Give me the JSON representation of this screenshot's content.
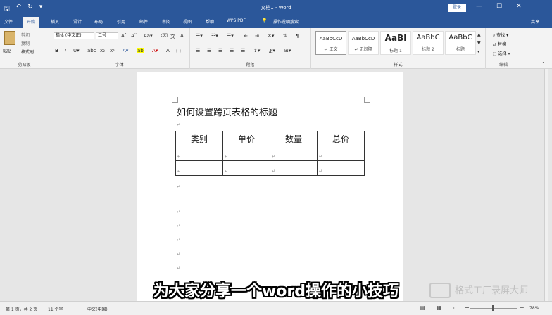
{
  "titlebar": {
    "title": "文档1 - Word",
    "login": "登录",
    "minimize": "—",
    "restore": "☐",
    "close": "✕"
  },
  "tabs": [
    "文件",
    "开始",
    "插入",
    "设计",
    "布局",
    "引用",
    "邮件",
    "审阅",
    "视图",
    "帮助",
    "WPS PDF"
  ],
  "tell_me": "操作说明搜索",
  "share": "共享",
  "clipboard": {
    "paste": "粘贴",
    "cut": "剪切",
    "copy": "复制",
    "format_painter": "格式刷",
    "group": "剪贴板"
  },
  "font": {
    "name": "楷体 (中文正)",
    "size": "二号",
    "group": "字体"
  },
  "paragraph": {
    "group": "段落"
  },
  "styles": {
    "items": [
      {
        "preview": "AaBbCcD",
        "name": "↵ 正文"
      },
      {
        "preview": "AaBbCcD",
        "name": "↵ 无间隔"
      },
      {
        "preview": "AaBl",
        "name": "标题 1"
      },
      {
        "preview": "AaBbC",
        "name": "标题 2"
      },
      {
        "preview": "AaBbC",
        "name": "标题"
      }
    ],
    "group": "样式"
  },
  "editing": {
    "find": "查找",
    "replace": "替换",
    "select": "选择",
    "group": "编辑"
  },
  "document": {
    "title": "如何设置跨页表格的标题",
    "table_headers": [
      "类别",
      "单价",
      "数量",
      "总价"
    ]
  },
  "caption": "为大家分享一个word操作的小技巧",
  "watermark": "格式工厂录屏大师",
  "status": {
    "page": "第 1 页，共 2 页",
    "words": "11 个字",
    "lang": "中文(中国)",
    "zoom": "78%"
  }
}
